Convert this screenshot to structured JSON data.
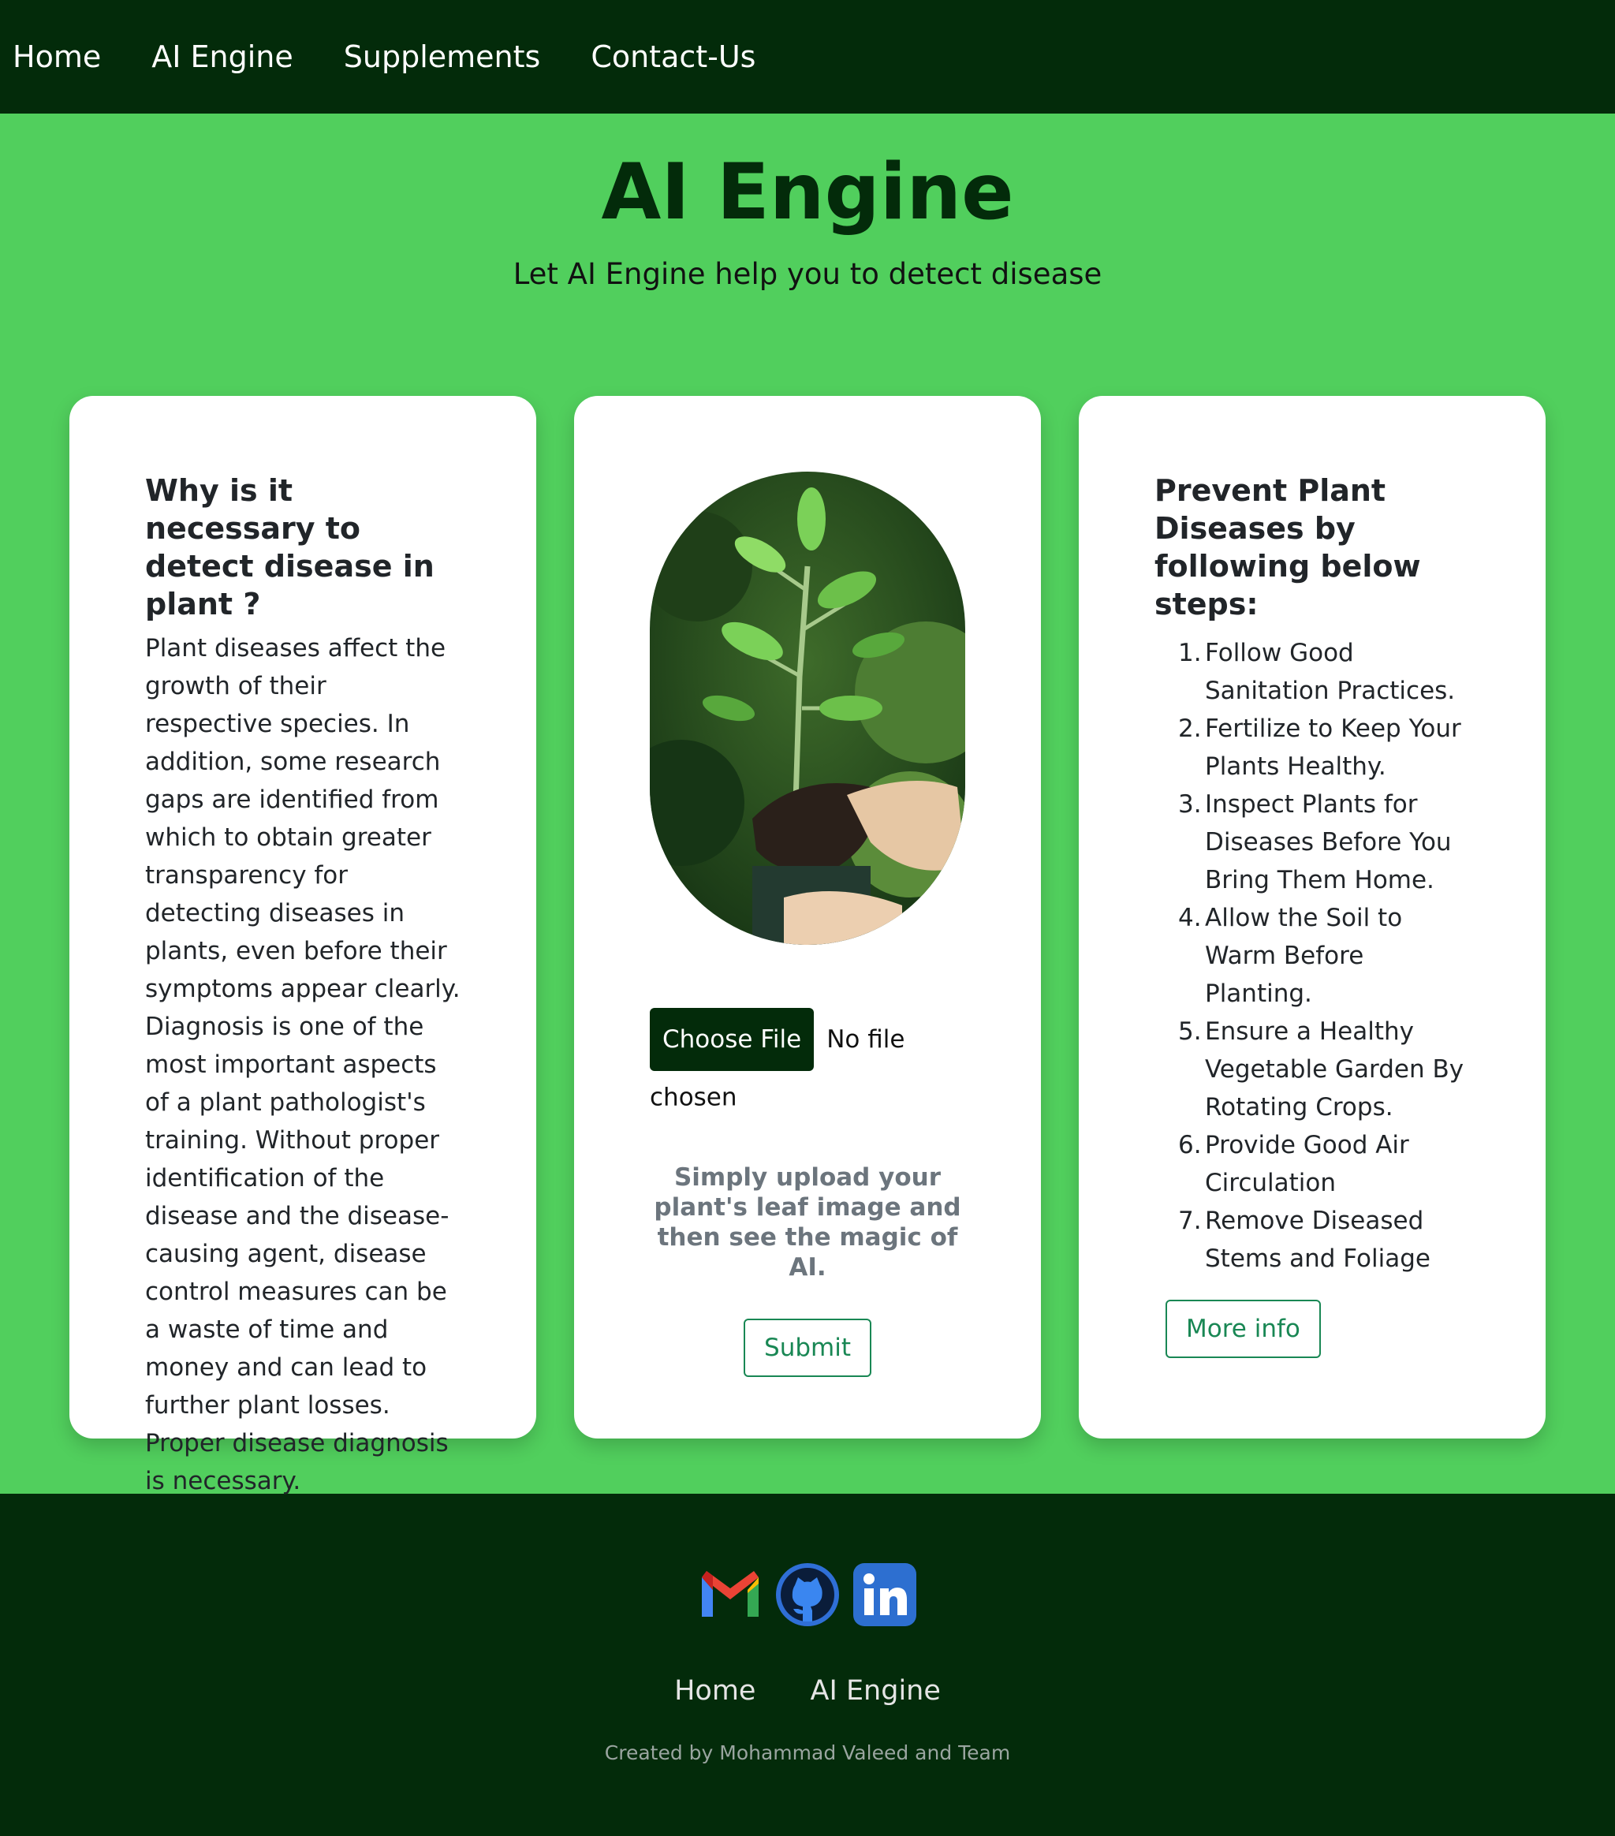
{
  "nav": {
    "items": [
      "Home",
      "AI Engine",
      "Supplements",
      "Contact-Us"
    ]
  },
  "hero": {
    "title": "AI Engine",
    "subtitle": "Let AI Engine help you to detect disease"
  },
  "left_card": {
    "title": "Why is it necessary to detect disease in plant ?",
    "text": "Plant diseases affect the growth of their respective species. In addition, some research gaps are identified from which to obtain greater transparency for detecting diseases in plants, even before their symptoms appear clearly. Diagnosis is one of the most important aspects of a plant pathologist's training. Without proper identification of the disease and the disease-causing agent, disease control measures can be a waste of time and money and can lead to further plant losses. Proper disease diagnosis is necessary."
  },
  "middle_card": {
    "choose_file_label": "Choose File",
    "file_status": "No file chosen",
    "hint": "Simply upload your plant's leaf image and then see the magic of AI.",
    "submit_label": "Submit"
  },
  "right_card": {
    "title": "Prevent Plant Diseases by following below steps:",
    "steps": [
      "Follow Good Sanitation Practices.",
      "Fertilize to Keep Your Plants Healthy.",
      "Inspect Plants for Diseases Before You Bring Them Home.",
      "Allow the Soil to Warm Before Planting.",
      "Ensure a Healthy Vegetable Garden By Rotating Crops.",
      "Provide Good Air Circulation",
      "Remove Diseased Stems and Foliage"
    ],
    "more_info_label": "More info"
  },
  "footer": {
    "social_icons": [
      "gmail-icon",
      "github-icon",
      "linkedin-icon"
    ],
    "links": [
      "Home",
      "AI Engine"
    ],
    "credit": "Created by Mohammad Valeed and Team"
  },
  "colors": {
    "navbar_bg": "#032b0a",
    "page_bg": "#51cf5d",
    "accent_outline": "#198754",
    "hint_text": "#6c757d"
  }
}
